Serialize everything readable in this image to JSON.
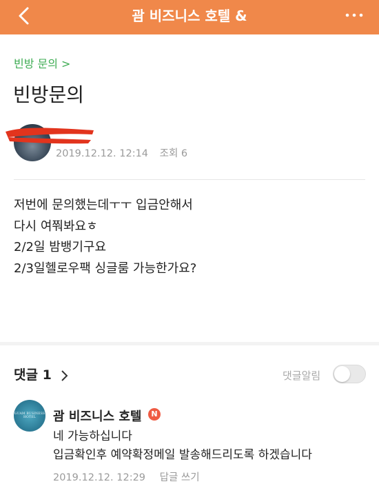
{
  "header": {
    "title": "괌 비즈니스 호텔 &",
    "back_icon": "chevron-left-icon",
    "more_icon": "more-horizontal-icon",
    "bar_color": "#f0884a"
  },
  "post": {
    "breadcrumb": "빈방 문의 >",
    "title": "빈방문의",
    "date": "2019.12.12. 12:14",
    "views": "조회 6",
    "body": [
      "저번에 문의했는데ㅜㅜ 입금안해서",
      "다시 여쭤봐요ㅎ",
      "2/2일 밤뱅기구요",
      "2/3일헬로우팩 싱글룸 가능한가요?"
    ]
  },
  "comments": {
    "header": "댓글 1",
    "notify_label": "댓글알림",
    "notify_on": false,
    "items": [
      {
        "author": "괌 비즈니스 호텔",
        "avatar_text": "GUAM BUSINESS HOTEL",
        "new_badge": "N",
        "lines": [
          "네 가능하십니다",
          "입금확인후 예약확정메일 발송해드리도록 하겠습니다"
        ],
        "date": "2019.12.12. 12:29",
        "reply_label": "답글 쓰기"
      }
    ]
  },
  "colors": {
    "accent": "#f0884a",
    "breadcrumb": "#3eac53",
    "badge": "#ef5b43"
  }
}
